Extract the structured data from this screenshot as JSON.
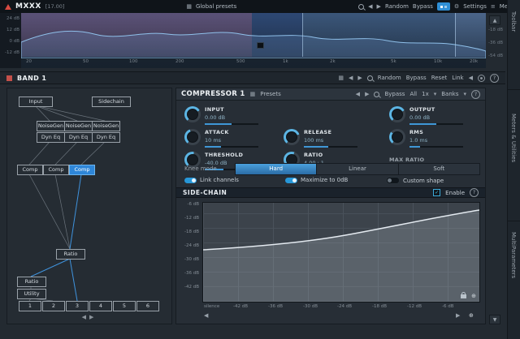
{
  "titlebar": {
    "app_name": "MXXX",
    "version": "[17.00]",
    "presets": "Global presets",
    "random": "Random",
    "bypass": "Bypass",
    "settings": "Settings",
    "menu": "Menu"
  },
  "spectrum": {
    "db_labels_left": [
      "24 dB",
      "12 dB",
      "0 dB",
      "-12 dB"
    ],
    "db_labels_right": [
      "-18 dB",
      "-36 dB",
      "-54 dB"
    ],
    "freq_labels": [
      "20",
      "50",
      "100",
      "200",
      "500",
      "1k",
      "2k",
      "5k",
      "10k",
      "20k"
    ]
  },
  "band": {
    "title": "BAND 1",
    "actions": {
      "random": "Random",
      "bypass": "Bypass",
      "reset": "Reset",
      "link": "Link"
    }
  },
  "node_graph": {
    "input": "Input",
    "sidechain": "Sidechain",
    "noisegens": [
      "NoiseGen",
      "NoiseGen",
      "NoiseGen"
    ],
    "dyneqs": [
      "Dyn Eq",
      "Dyn Eq",
      "Dyn Eq"
    ],
    "comps": [
      "Comp",
      "Comp",
      "Comp"
    ],
    "ratio_a": "Ratio",
    "ratio_b": "Ratio",
    "utility": "Utility",
    "slots": [
      "1",
      "2",
      "3",
      "4",
      "5",
      "6"
    ]
  },
  "compressor": {
    "title": "COMPRESSOR 1",
    "presets": "Presets",
    "bypass": "Bypass",
    "channels": "All",
    "oversampling": "1x",
    "banks": "Banks",
    "knobs": {
      "input": {
        "label": "INPUT",
        "value": "0.00 dB"
      },
      "output": {
        "label": "OUTPUT",
        "value": "0.00 dB"
      },
      "attack": {
        "label": "ATTACK",
        "value": "10 ms"
      },
      "release": {
        "label": "RELEASE",
        "value": "100 ms"
      },
      "rms": {
        "label": "RMS",
        "value": "1.0 ms"
      },
      "threshold": {
        "label": "THRESHOLD",
        "value": "-40.0 dB"
      },
      "ratio": {
        "label": "RATIO",
        "value": "4.00 : 1"
      },
      "max_ratio": {
        "label": "MAX RATIO"
      }
    },
    "knee": {
      "label": "Knee mode",
      "options": [
        "Hard",
        "Linear",
        "Soft"
      ],
      "selected": "Hard"
    },
    "toggles": [
      {
        "label": "Link channels"
      },
      {
        "label": "Maximize to 0dB"
      },
      {
        "label": "Custom shape"
      }
    ],
    "sidechain": {
      "title": "SIDE-CHAIN",
      "enable": "Enable"
    },
    "graph": {
      "y_labels": [
        "-6 dB",
        "-12 dB",
        "-18 dB",
        "-24 dB",
        "-30 dB",
        "-36 dB",
        "-42 dB"
      ],
      "x_labels": [
        "silence",
        "-42 dB",
        "-36 dB",
        "-30 dB",
        "-24 dB",
        "-18 dB",
        "-12 dB",
        "-6 dB"
      ]
    }
  },
  "sidebar": {
    "tabs": [
      "Toolbar",
      "Meters & Utilities",
      "MultiParameters"
    ]
  },
  "glyphs": {
    "up": "▲",
    "down": "▼",
    "left": "◀",
    "right": "▶",
    "grid": "▦",
    "gear": "⚙",
    "menu": "≡",
    "help": "?",
    "check": "✓",
    "zoom": "⊕",
    "caret": "▾"
  },
  "colors": {
    "accent": "#2f8fd6",
    "band_red": "#b5534e",
    "selected_node": "#2e86d8"
  }
}
